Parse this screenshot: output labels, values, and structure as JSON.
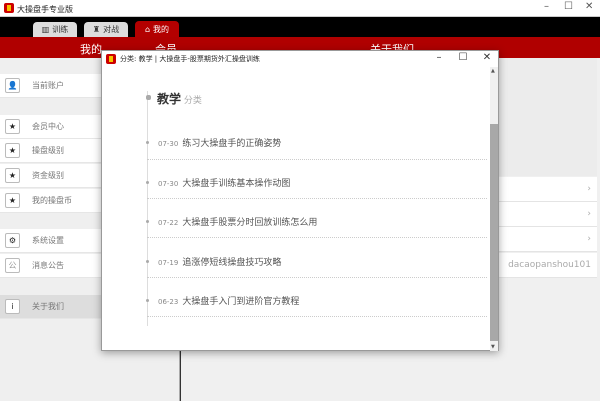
{
  "app": {
    "title": "大操盘手专业版"
  },
  "tabs": [
    {
      "label": "训练",
      "icon": "chart-icon"
    },
    {
      "label": "对战",
      "icon": "castle-icon"
    },
    {
      "label": "我的",
      "icon": "home-icon",
      "active": true
    }
  ],
  "header": {
    "left": "我的",
    "mid": "会员",
    "right": "关于我们"
  },
  "sidebar": {
    "items": [
      {
        "label": "当前账户",
        "icon": "user-icon"
      },
      {
        "label": "会员中心",
        "icon": "star-icon"
      },
      {
        "label": "操盘级别",
        "icon": "star-icon"
      },
      {
        "label": "资金级别",
        "icon": "star-icon"
      },
      {
        "label": "我的操盘币",
        "icon": "star-icon"
      },
      {
        "label": "系统设置",
        "icon": "gears-icon"
      },
      {
        "label": "消息公告",
        "icon": "notice-icon"
      },
      {
        "label": "关于我们",
        "icon": "info-icon"
      }
    ]
  },
  "right_rows": [
    {
      "value": "›"
    },
    {
      "value": "›"
    },
    {
      "value": "›"
    },
    {
      "value": "dacaopanshou101"
    }
  ],
  "modal": {
    "title": "分类: 教学 | 大操盘手-股票期货外汇操盘训练",
    "heading": "教学",
    "heading_sub": "分类",
    "articles": [
      {
        "date": "07-30",
        "title": "练习大操盘手的正确姿势"
      },
      {
        "date": "07-30",
        "title": "大操盘手训练基本操作动图"
      },
      {
        "date": "07-22",
        "title": "大操盘手股票分时回放训练怎么用"
      },
      {
        "date": "07-19",
        "title": "追涨停短线操盘技巧攻略"
      },
      {
        "date": "06-23",
        "title": "大操盘手入门到进阶官方教程"
      }
    ]
  },
  "colors": {
    "brand_red": "#b00000",
    "header_black": "#000000"
  }
}
